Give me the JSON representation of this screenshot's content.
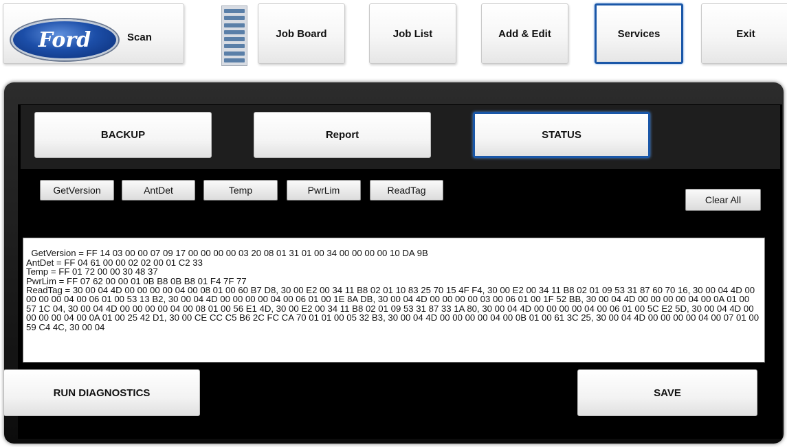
{
  "nav": {
    "logo_text": "Ford",
    "scan_label": "Scan",
    "job_board_label": "Job Board",
    "job_list_label": "Job List",
    "add_edit_label": "Add & Edit",
    "services_label": "Services",
    "exit_label": "Exit",
    "active_item": "Services"
  },
  "tabs": {
    "backup_label": "BACKUP",
    "report_label": "Report",
    "status_label": "STATUS",
    "active_tab": "STATUS"
  },
  "commands": {
    "get_version_label": "GetVersion",
    "ant_det_label": "AntDet",
    "temp_label": "Temp",
    "pwr_lim_label": "PwrLim",
    "read_tag_label": "ReadTag",
    "clear_all_label": "Clear All"
  },
  "output": {
    "text": "GetVersion = FF 14 03 00 00 07 09 17 00 00 00 00 03 20 08 01 31 01 00 34 00 00 00 00 10 DA 9B\nAntDet = FF 04 61 00 00 02 02 00 01 C2 33\nTemp = FF 01 72 00 00 30 48 37\nPwrLim = FF 07 62 00 00 01 0B B8 0B B8 01 F4 7F 77\nReadTag = 30 00 04 4D 00 00 00 00 04 00 08 01 00 60 B7 D8, 30 00 E2 00 34 11 B8 02 01 10 83 25 70 15 4F F4, 30 00 E2 00 34 11 B8 02 01 09 53 31 87 60 70 16, 30 00 04 4D 00 00 00 00 04 00 06 01 00 53 13 B2, 30 00 04 4D 00 00 00 00 04 00 06 01 00 1E 8A DB, 30 00 04 4D 00 00 00 00 03 00 06 01 00 1F 52 BB, 30 00 04 4D 00 00 00 00 04 00 0A 01 00 57 1C 04, 30 00 04 4D 00 00 00 00 04 00 08 01 00 56 E1 4D, 30 00 E2 00 34 11 B8 02 01 09 53 31 87 33 1A 80, 30 00 04 4D 00 00 00 00 04 00 06 01 00 5C E2 5D, 30 00 04 4D 00 00 00 00 04 00 0A 01 00 25 42 D1, 30 00 CE CC C5 B6 2C FC CA 70 01 01 00 05 32 B3, 30 00 04 4D 00 00 00 00 04 00 0B 01 00 61 3C 25, 30 00 04 4D 00 00 00 00 04 00 07 01 00 59 C4 4C, 30 00 04"
  },
  "actions": {
    "run_diagnostics_label": "RUN DIAGNOSTICS",
    "save_label": "SAVE"
  },
  "colors": {
    "accent": "#1a57a8",
    "panel_bg": "#000000",
    "tab_strip_bg": "#1e1e1e"
  },
  "icons": {
    "menu": "hamburger-icon",
    "logo": "ford-logo"
  }
}
